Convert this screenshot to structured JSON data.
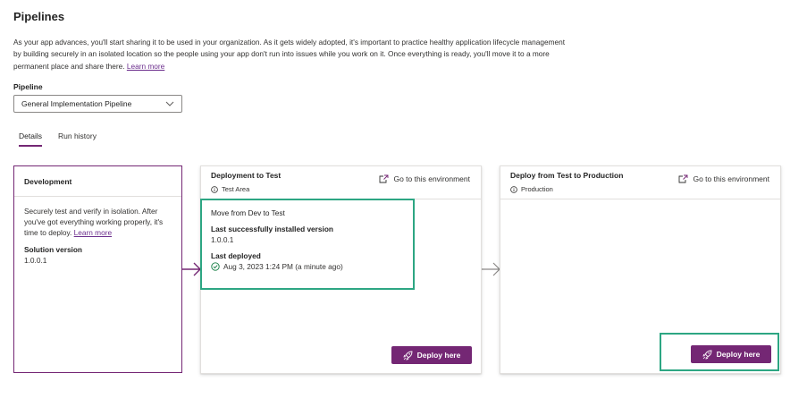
{
  "page": {
    "title": "Pipelines",
    "intro_text": "As your app advances, you'll start sharing it to be used in your organization. As it gets widely adopted, it's important to practice healthy application lifecycle management by building securely in an isolated location so the people using your app don't run into issues while you work on it. Once everything is ready, you'll move it to a more permanent place and share there.",
    "intro_link": "Learn more"
  },
  "pipeline": {
    "label": "Pipeline",
    "selected": "General Implementation Pipeline"
  },
  "tabs": [
    {
      "label": "Details",
      "active": true
    },
    {
      "label": "Run history",
      "active": false
    }
  ],
  "development": {
    "title": "Development",
    "description": "Securely test and verify in isolation. After you've got everything working properly, it's time to deploy.",
    "link": "Learn more",
    "solution_version_label": "Solution version",
    "solution_version": "1.0.0.1"
  },
  "stages": [
    {
      "title": "Deployment to Test",
      "environment": "Test Area",
      "goto_label": "Go to this environment",
      "run": {
        "title": "Move from Dev to Test",
        "installed_label": "Last successfully installed version",
        "installed_version": "1.0.0.1",
        "deployed_label": "Last deployed",
        "deployed_value": "Aug 3, 2023 1:24 PM (a minute ago)"
      },
      "deploy_label": "Deploy here"
    },
    {
      "title": "Deploy from Test to Production",
      "environment": "Production",
      "goto_label": "Go to this environment",
      "deploy_label": "Deploy here"
    }
  ],
  "colors": {
    "accent": "#742774",
    "highlight": "#2da683",
    "link": "#6b2d8c"
  },
  "icons": {
    "dropdown": "chevron-down-icon",
    "environment": "info-icon",
    "goto": "open-external-icon",
    "deploy": "rocket-icon",
    "deployed": "check-circle-icon",
    "connector": "arrow-right-icon"
  }
}
